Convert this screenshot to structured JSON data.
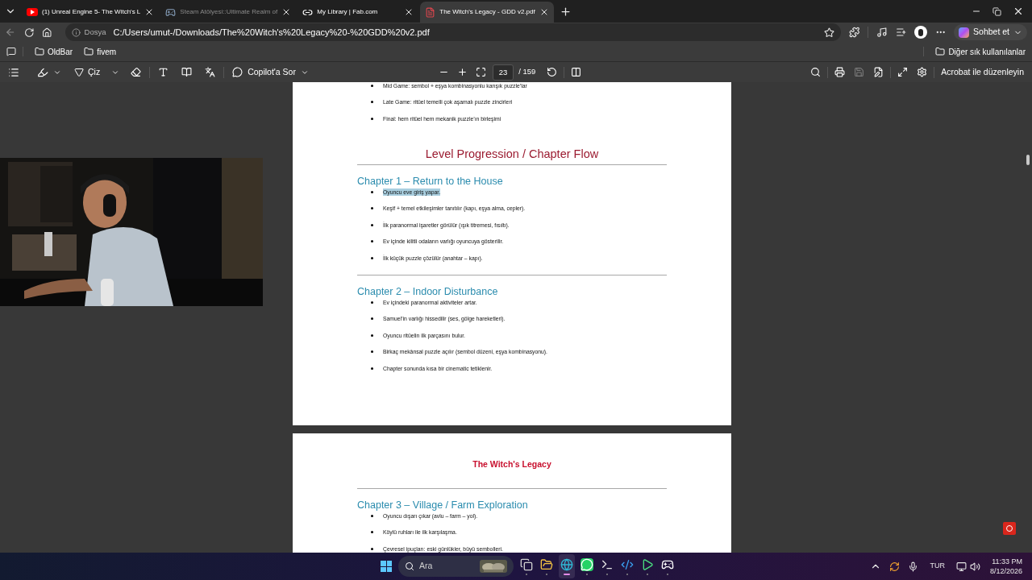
{
  "browser": {
    "tabs": [
      {
        "kind": "youtube",
        "title": "(1) Unreal Engine 5- The Witch's L",
        "selected": false,
        "faded": false
      },
      {
        "kind": "steam",
        "title": "Steam Atölyesi::Ultimate Realm of",
        "selected": false,
        "faded": true
      },
      {
        "kind": "link",
        "title": "My Library | Fab.com",
        "selected": false,
        "faded": false
      },
      {
        "kind": "pdf",
        "title": "The Witch's Legacy - GDD v2.pdf",
        "selected": true,
        "faded": false
      }
    ],
    "address": {
      "label": "Dosya",
      "url": "C:/Users/umut-/Downloads/The%20Witch's%20Legacy%20-%20GDD%20v2.pdf"
    },
    "copilot_button": "Sohbet et",
    "bookmarks": [
      {
        "label": "OldBar"
      },
      {
        "label": "fivem"
      }
    ],
    "other_bookmarks": "Diğer sık kullanılanlar"
  },
  "pdf_toolbar": {
    "draw_label": "Çiz",
    "copilot_label": "Copilot'a Sor",
    "page_number": "23",
    "page_total": "/ 159",
    "edit_button": "Acrobat ile düzenleyin"
  },
  "pages": [
    {
      "blocks": [
        {
          "kind": "bullet",
          "text": "Mid Game: sembol + eşya kombinasyonlu karışık puzzle’lar",
          "highlighted": false
        },
        {
          "kind": "bullet",
          "text": "Late Game: ritüel temelli çok aşamalı puzzle zincirleri",
          "highlighted": false
        },
        {
          "kind": "bullet",
          "text": "Final: hem ritüel hem mekanik puzzle’ın birleşimi",
          "highlighted": false
        },
        {
          "kind": "title",
          "text": "Level Progression / Chapter Flow"
        },
        {
          "kind": "rule"
        },
        {
          "kind": "chapter",
          "text": "Chapter 1 – Return to the House"
        },
        {
          "kind": "bullet",
          "text": "Oyuncu eve giriş yapar.",
          "highlighted": true
        },
        {
          "kind": "bullet",
          "text": "Keşif + temel etkileşimler tanıtılır (kapı, eşya alma, cepler).",
          "highlighted": false
        },
        {
          "kind": "bullet",
          "text": "İlk paranormal işaretler görülür (ışık titremesi, fısıltı).",
          "highlighted": false
        },
        {
          "kind": "bullet",
          "text": "Ev içinde kilitli odaların varlığı oyuncuya gösterilir.",
          "highlighted": false
        },
        {
          "kind": "bullet",
          "text": "İlk küçük puzzle çözülür (anahtar – kapı).",
          "highlighted": false
        },
        {
          "kind": "rule"
        },
        {
          "kind": "chapter",
          "text": "Chapter 2 – Indoor Disturbance"
        },
        {
          "kind": "bullet",
          "text": "Ev içindeki paranormal aktiviteler artar.",
          "highlighted": false
        },
        {
          "kind": "bullet",
          "text": "Samuel’in varlığı hissedilir (ses, gölge hareketleri).",
          "highlighted": false
        },
        {
          "kind": "bullet",
          "text": "Oyuncu ritüelin ilk parçasını bulur.",
          "highlighted": false
        },
        {
          "kind": "bullet",
          "text": "Birkaç mekânsal puzzle açılır (sembol düzeni, eşya kombinasyonu).",
          "highlighted": false
        },
        {
          "kind": "bullet",
          "text": "Chapter sonunda kısa bir cinematic tetiklenir.",
          "highlighted": false
        }
      ]
    },
    {
      "blocks": [
        {
          "kind": "header",
          "text": "The Witch's Legacy"
        },
        {
          "kind": "rule"
        },
        {
          "kind": "chapter",
          "text": "Chapter 3 – Village / Farm Exploration"
        },
        {
          "kind": "bullet",
          "text": "Oyuncu dışarı çıkar (avlu – farm – yol).",
          "highlighted": false
        },
        {
          "kind": "bullet",
          "text": "Köylü ruhları ile ilk karşılaşma.",
          "highlighted": false
        },
        {
          "kind": "bullet",
          "text": "Çevresel ipuçları: eski günlükler, büyü sembolleri.",
          "highlighted": false
        }
      ]
    }
  ],
  "taskbar": {
    "search_placeholder": "Ara",
    "apps": [
      {
        "kind": "files",
        "selected": false
      },
      {
        "kind": "folder",
        "selected": false
      },
      {
        "kind": "edge",
        "selected": true
      },
      {
        "kind": "whatsapp",
        "selected": false
      },
      {
        "kind": "terminal",
        "selected": false
      },
      {
        "kind": "vscode",
        "selected": false
      },
      {
        "kind": "play",
        "selected": false
      },
      {
        "kind": "epic",
        "selected": false
      }
    ],
    "language": "TUR",
    "time": "11:33 PM",
    "date": "8/12/2026"
  }
}
